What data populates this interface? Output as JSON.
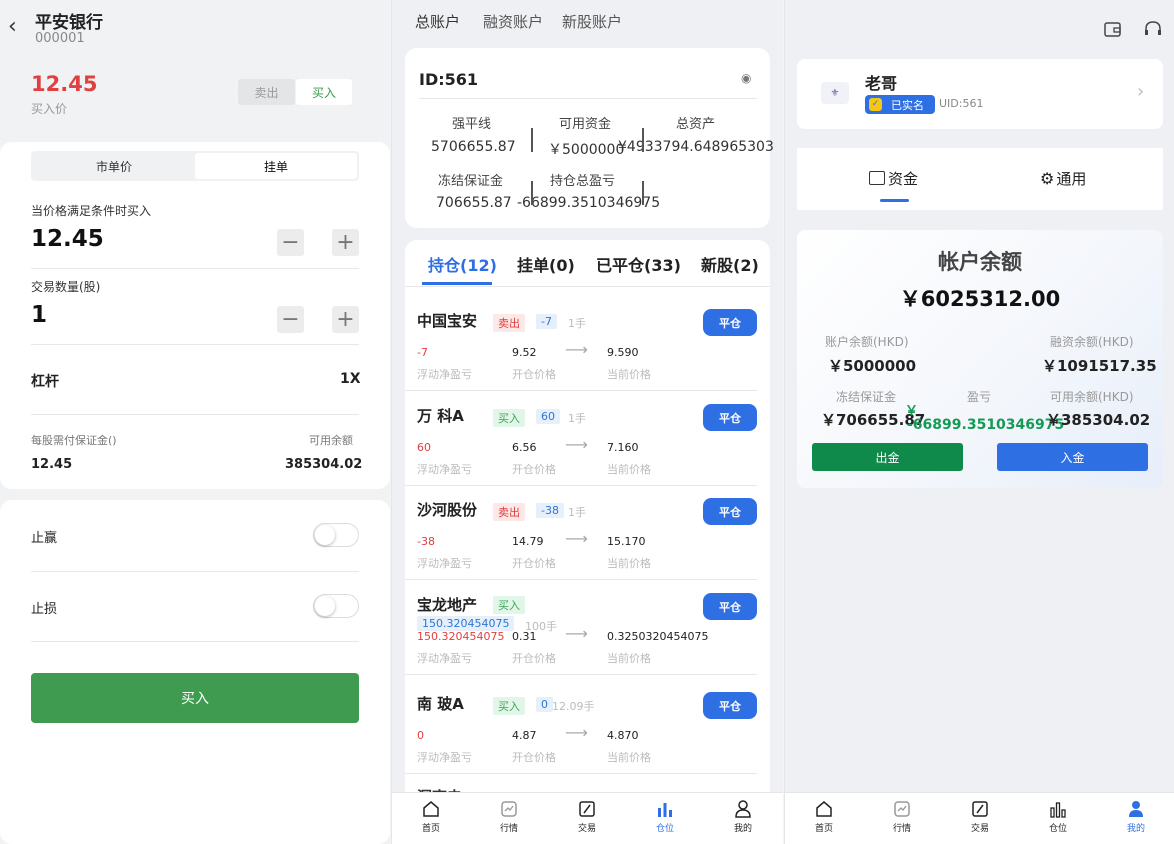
{
  "left": {
    "stock_name": "平安银行",
    "stock_code": "000001",
    "price": "12.45",
    "price_label": "买入价",
    "sell": "卖出",
    "buy": "买入",
    "tab_market": "市单价",
    "tab_limit": "挂单",
    "cond_label": "当价格满足条件时买入",
    "cond_value": "12.45",
    "qty_label": "交易数量(股)",
    "qty_value": "1",
    "lev_label": "杠杆",
    "lev_value": "1X",
    "margin_label": "每股需付保证金()",
    "margin_value": "12.45",
    "avail_label": "可用余额",
    "avail_value": "385304.02",
    "tp": "止赢",
    "sl": "止损",
    "buy_button": "买入"
  },
  "mid": {
    "tabs": [
      "总账户",
      "融资账户",
      "新股账户"
    ],
    "id": "ID:561",
    "stats": [
      {
        "label": "强平线",
        "value": "5706655.87"
      },
      {
        "label": "可用资金",
        "value": "￥5000000"
      },
      {
        "label": "总资产",
        "value": "¥4933794.648965303"
      },
      {
        "label": "冻结保证金",
        "value": "706655.87"
      },
      {
        "label": "持仓总盈亏",
        "value": "-66899.3510346975"
      }
    ],
    "pos_tabs": [
      "持仓(12)",
      "挂单(0)",
      "已平仓(33)",
      "新股(2)"
    ],
    "positions": [
      {
        "name": "中国宝安",
        "dir": "卖出",
        "qty": "-7",
        "lot": "1手",
        "pl": "-7",
        "open": "9.52",
        "cur": "9.590",
        "pl_type": "sell"
      },
      {
        "name": "万 科A",
        "dir": "买入",
        "qty": "60",
        "lot": "1手",
        "pl": "60",
        "open": "6.56",
        "cur": "7.160",
        "pl_type": "buy"
      },
      {
        "name": "沙河股份",
        "dir": "卖出",
        "qty": "-38",
        "lot": "1手",
        "pl": "-38",
        "open": "14.79",
        "cur": "15.170",
        "pl_type": "sell"
      },
      {
        "name": "宝龙地产",
        "dir": "买入",
        "qty": "150.320454075",
        "lot": "100手",
        "pl": "150.320454075",
        "open": "0.31",
        "cur": "0.3250320454075",
        "pl_type": "buy"
      },
      {
        "name": "南 玻A",
        "dir": "买入",
        "qty": "0",
        "lot": "12.09手",
        "pl": "0",
        "open": "4.87",
        "cur": "4.870",
        "pl_type": "buy"
      }
    ],
    "l_pl": "浮动净盈亏",
    "l_open": "开仓价格",
    "l_cur": "当前价格",
    "close": "平仓",
    "cut_text": "深南电"
  },
  "right": {
    "name": "老哥",
    "verified": "已实名",
    "uid": "UID:561",
    "tab_funds": "资金",
    "tab_general": "通用",
    "balance_title": "帐户余额",
    "balance": "￥6025312.00",
    "items": [
      {
        "label": "账户余额(HKD)",
        "value": "￥5000000"
      },
      {
        "label": "融资余额(HKD)",
        "value": "￥1091517.35"
      },
      {
        "label": "冻结保证金",
        "value": "￥706655.87"
      },
      {
        "label": "盈亏",
        "value": "-66899.3510346975"
      },
      {
        "label": "可用余额(HKD)",
        "value": "￥385304.02"
      }
    ],
    "pl_currency": "￥",
    "withdraw": "出金",
    "deposit": "入金"
  },
  "nav": [
    "首页",
    "行情",
    "交易",
    "仓位",
    "我的"
  ]
}
